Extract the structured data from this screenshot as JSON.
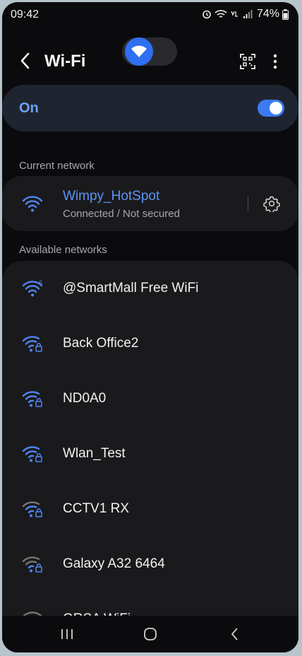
{
  "status_bar": {
    "time": "09:42",
    "battery": "74%",
    "icons": [
      "alarm-icon",
      "wifi-status-icon",
      "volte-icon",
      "signal-icon",
      "battery-icon"
    ]
  },
  "app_bar": {
    "title": "Wi-Fi",
    "icons": [
      "back-icon",
      "wifi-toggle-icon",
      "qr-code-icon",
      "more-options-icon"
    ]
  },
  "master_switch": {
    "label": "On",
    "enabled": true
  },
  "current_section": {
    "label": "Current network",
    "network": {
      "name": "Wimpy_HotSpot",
      "status": "Connected / Not secured",
      "icon": "wifi-icon"
    }
  },
  "available_section": {
    "label": "Available networks",
    "networks": [
      {
        "name": "@SmartMall Free WiFi",
        "icon": "wifi-6-icon",
        "secured": false
      },
      {
        "name": "Back Office2",
        "icon": "wifi-lock-icon",
        "secured": true
      },
      {
        "name": "ND0A0",
        "icon": "wifi-lock-icon",
        "secured": true
      },
      {
        "name": "Wlan_Test",
        "icon": "wifi-lock-icon",
        "secured": true
      },
      {
        "name": "CCTV1 RX",
        "icon": "wifi-lock-icon",
        "secured": true
      },
      {
        "name": "Galaxy A32 6464",
        "icon": "wifi-lock-icon",
        "secured": true
      },
      {
        "name": "GRSA WiFi",
        "icon": "wifi-icon",
        "secured": false
      }
    ]
  },
  "nav_bar": {
    "icons": [
      "recent-apps-icon",
      "home-icon",
      "back-nav-icon"
    ]
  },
  "colors": {
    "accent": "#3a7bf2",
    "link_blue": "#5d93f7",
    "card": "#1a1a1d",
    "background": "#0b0b0d"
  }
}
